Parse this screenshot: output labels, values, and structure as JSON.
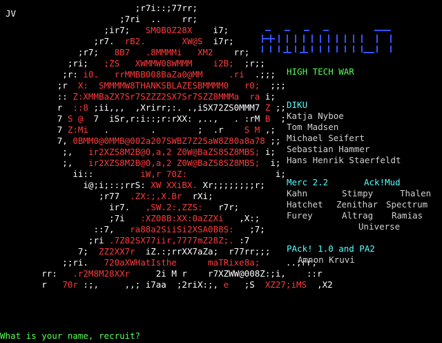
{
  "corner_tag": "JV",
  "logo": {
    "colors": {
      "line": "#3355ff",
      "dash": "#3355ff"
    }
  },
  "art_lines": [
    [
      {
        "t": "                          ;r7i::;77rr;",
        "c": "w"
      }
    ],
    [
      {
        "t": "                       ;7ri  ..    rr;",
        "c": "w"
      }
    ],
    [
      {
        "t": "                    ;ir7;   ",
        "c": "w"
      },
      {
        "t": "SM0B0Z28X",
        "c": "r"
      },
      {
        "t": "    i7;",
        "c": "w"
      }
    ],
    [
      {
        "t": "                  ;r7.  ",
        "c": "w"
      },
      {
        "t": "rB2.",
        "c": "r"
      },
      {
        "t": "       ",
        "c": "w"
      },
      {
        "t": "XW@S",
        "c": "r"
      },
      {
        "t": "  i7r;",
        "c": "w"
      }
    ],
    [
      {
        "t": "               ;r7;   ",
        "c": "w"
      },
      {
        "t": "8B7",
        "c": "r"
      },
      {
        "t": "   ",
        "c": "w"
      },
      {
        "t": ".8MMMMi",
        "c": "r"
      },
      {
        "t": "   ",
        "c": "w"
      },
      {
        "t": "XM2",
        "c": "r"
      },
      {
        "t": "    rr;",
        "c": "w"
      }
    ],
    [
      {
        "t": "             ;ri;   ",
        "c": "w"
      },
      {
        "t": ";ZS",
        "c": "r"
      },
      {
        "t": "   ",
        "c": "w"
      },
      {
        "t": "XWMMW08WMMM",
        "c": "r"
      },
      {
        "t": "    ",
        "c": "w"
      },
      {
        "t": "i2B;",
        "c": "r"
      },
      {
        "t": "  ;r;;",
        "c": "w"
      }
    ],
    [
      {
        "t": "            ;r: ",
        "c": "w"
      },
      {
        "t": "i0.",
        "c": "r"
      },
      {
        "t": "   ",
        "c": "w"
      },
      {
        "t": "rrMMBB008BaZa0@MM",
        "c": "r"
      },
      {
        "t": "     ",
        "c": "w"
      },
      {
        "t": ".ri",
        "c": "r"
      },
      {
        "t": "  .;;;",
        "c": "w"
      }
    ],
    [
      {
        "t": "           ;r  ",
        "c": "w"
      },
      {
        "t": "X:  SMMMMW8THANKSBLAZESBMMMM0",
        "c": "r"
      },
      {
        "t": "   ",
        "c": "w"
      },
      {
        "t": "r0;",
        "c": "r"
      },
      {
        "t": "  ;;;",
        "c": "w"
      }
    ],
    [
      {
        "t": "           :: ",
        "c": "w"
      },
      {
        "t": "Z:XMMBaZX7Sr7SZZZ2SX7Sr7SZZ8MMMa",
        "c": "r"
      },
      {
        "t": "  ",
        "c": "w"
      },
      {
        "t": "ra",
        "c": "r"
      },
      {
        "t": " i;",
        "c": "w"
      }
    ],
    [
      {
        "t": "           r  ",
        "c": "w"
      },
      {
        "t": "::8",
        "c": "r"
      },
      {
        "t": " ;ii,,,  ,Xrirr;:. .,iSX72ZS0MMM7 ",
        "c": "w"
      },
      {
        "t": "Z",
        "c": "r"
      },
      {
        "t": " ;;",
        "c": "w"
      }
    ],
    [
      {
        "t": "           7 ",
        "c": "w"
      },
      {
        "t": "S @",
        "c": "r"
      },
      {
        "t": "  7  iSr,r:i::;r:rXX: ,..,   . :rM ",
        "c": "w"
      },
      {
        "t": "B",
        "c": "r"
      },
      {
        "t": "  ;",
        "c": "w"
      }
    ],
    [
      {
        "t": "           7 ",
        "c": "w"
      },
      {
        "t": "Z:Mi",
        "c": "r"
      },
      {
        "t": "   .        .        ;  .r    ",
        "c": "w"
      },
      {
        "t": "S M",
        "c": "r"
      },
      {
        "t": " ,;",
        "c": "w"
      }
    ],
    [
      {
        "t": "           7, ",
        "c": "w"
      },
      {
        "t": "0BMM0@0MMB@002a207SWBZ7Z2SaW8Z80a8a78",
        "c": "r"
      },
      {
        "t": " ;;",
        "c": "w"
      }
    ],
    [
      {
        "t": "            ;,   ",
        "c": "w"
      },
      {
        "t": "ir2XZS8M2B@0,a,2 Z0W@BaZS8SZ8MBS;",
        "c": "r"
      },
      {
        "t": " i;",
        "c": "w"
      }
    ],
    [
      {
        "t": "            ;,   ",
        "c": "w"
      },
      {
        "t": "ir2XZS8M2B@0,a,2 Z0W@BaZS8SZ8MBS;",
        "c": "r"
      },
      {
        "t": "  i;",
        "c": "w"
      }
    ],
    [
      {
        "t": "              ii::         ",
        "c": "w"
      },
      {
        "t": "iW,r 70Z:",
        "c": "r"
      },
      {
        "t": "                 i;",
        "c": "w"
      }
    ],
    [
      {
        "t": "                i@;i;::;rrS: ",
        "c": "w"
      },
      {
        "t": "XW XXiBX.",
        "c": "r"
      },
      {
        "t": " Xr;;;;;;;;r;",
        "c": "w"
      }
    ],
    [
      {
        "t": "                   ;r77  ",
        "c": "w"
      },
      {
        "t": ".ZX:;,X.Br",
        "c": "r"
      },
      {
        "t": "  rXi;",
        "c": "w"
      }
    ],
    [
      {
        "t": "                     ir7.   ",
        "c": "w"
      },
      {
        "t": ",SW.2:,ZZS:",
        "c": "r"
      },
      {
        "t": "   r7r;",
        "c": "w"
      }
    ],
    [
      {
        "t": "                     ;7i   ",
        "c": "w"
      },
      {
        "t": ":XZ08B:XX:0aZZXi",
        "c": "r"
      },
      {
        "t": "   ,X:;",
        "c": "w"
      }
    ],
    [
      {
        "t": "                  ::7,   ",
        "c": "w"
      },
      {
        "t": "ra88a2SiiSi2XSA0B8S:",
        "c": "r"
      },
      {
        "t": "   ;7;",
        "c": "w"
      }
    ],
    [
      {
        "t": "                 ;ri ",
        "c": "w"
      },
      {
        "t": ".7Z82SX77iir,7777mZ28Z;.",
        "c": "r"
      },
      {
        "t": " :7",
        "c": "w"
      }
    ],
    [
      {
        "t": "               7;  ",
        "c": "w"
      },
      {
        "t": "ZZ2XX7r",
        "c": "r"
      },
      {
        "t": "  iZ.:;rrXX7aZa;  r77rr;;;",
        "c": "w"
      }
    ],
    [
      {
        "t": "            ;;ri.   ",
        "c": "w"
      },
      {
        "t": "720aXWHatIsthe",
        "c": "r"
      },
      {
        "t": "      ",
        "c": "w"
      },
      {
        "t": "maTRixe8a;",
        "c": "r"
      },
      {
        "t": "     ..;rr;",
        "c": "w"
      }
    ],
    [
      {
        "t": "        rr:   ",
        "c": "w"
      },
      {
        "t": ".r2M8M28XXr",
        "c": "r"
      },
      {
        "t": "     2i M r    r7XZWW@008Z:;i,    ::r",
        "c": "w"
      }
    ],
    [
      {
        "t": "        r   ",
        "c": "w"
      },
      {
        "t": "70r",
        "c": "r"
      },
      {
        "t": " :;,     ,,; i7aa  ;2riX:;, ",
        "c": "w"
      },
      {
        "t": "e",
        "c": "r"
      },
      {
        "t": "   ;S  ",
        "c": "w"
      },
      {
        "t": "XZ27;iMS",
        "c": "r"
      },
      {
        "t": "  ,X2",
        "c": "w"
      }
    ]
  ],
  "info": {
    "tagline": "HIGH TECH WAR",
    "diku_header": "DIKU",
    "diku_authors": [
      "Katja Nyboe",
      "Tom Madsen",
      "Michael Seifert",
      "Sebastian Hammer",
      "Hans Henrik Staerfeldt"
    ],
    "merc_header": "Merc 2.2",
    "ack_header": "Ack!Mud",
    "merc_grid": [
      [
        "Kahn",
        "Stimpy",
        "Thalen"
      ],
      [
        "Hatchet",
        "Zenithar",
        "Spectrum"
      ],
      [
        "Furey",
        "Altrag",
        "Ramias"
      ],
      [
        "",
        "",
        "Universe"
      ]
    ],
    "pack_header": "PAck! 1.0 and PA2",
    "pack_author": "Amnon Kruvi"
  },
  "prompt": "What is your name, recruit?",
  "colors": {
    "background": "#000000",
    "art_white": "#ffffff",
    "art_red": "#ff3b3b",
    "tagline": "#55ff55",
    "headers": "#55ffff",
    "names": "#d0d0d0",
    "logo": "#3355ff",
    "prompt": "#55ff55"
  }
}
